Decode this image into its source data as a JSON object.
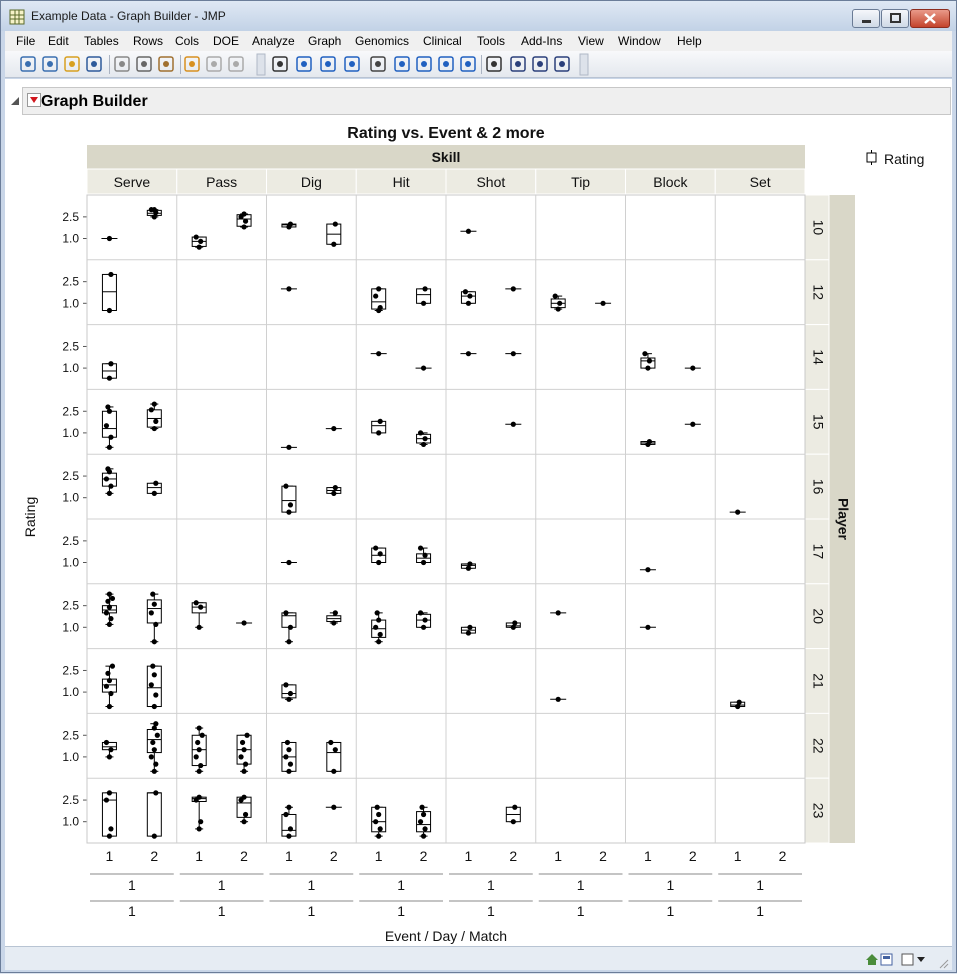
{
  "window": {
    "title": "Example Data - Graph Builder - JMP"
  },
  "menu": [
    "File",
    "Edit",
    "Tables",
    "Rows",
    "Cols",
    "DOE",
    "Analyze",
    "Graph",
    "Genomics",
    "Clinical",
    "Tools",
    "Add-Ins",
    "View",
    "Window",
    "Help"
  ],
  "toolbar_icons": [
    "new-data-table-icon",
    "new-script-icon",
    "open-icon",
    "save-icon",
    "cut-icon",
    "copy-icon",
    "paste-icon",
    "print-icon",
    "report-icon",
    "run-icon",
    "arrow-tool-icon",
    "help-tool-icon",
    "selection-tool-icon",
    "crosshair-tool-icon",
    "hand-tool-icon",
    "brush-tool-icon",
    "lasso-tool-icon",
    "magnifier-tool-icon",
    "crosshair-plus-icon",
    "annotate-icon",
    "line-tool-icon",
    "polygon-tool-icon",
    "simple-shape-icon"
  ],
  "graph_builder": {
    "title": "Graph Builder"
  },
  "chart_data": {
    "type": "box",
    "title": "Rating vs. Event & 2 more",
    "y_label": "Rating",
    "x_label": "Event / Day / Match",
    "group_x_label": "Skill",
    "group_y_label": "Player",
    "legend": "Rating",
    "skills": [
      "Serve",
      "Pass",
      "Dig",
      "Hit",
      "Shot",
      "Tip",
      "Block",
      "Set"
    ],
    "players": [
      "10",
      "12",
      "14",
      "15",
      "16",
      "17",
      "20",
      "21",
      "22",
      "23"
    ],
    "y_ticks": [
      "2.5",
      "1.0"
    ],
    "events": [
      "1",
      "2"
    ],
    "day_labels": [
      "1",
      "1",
      "1",
      "1",
      "1",
      "1",
      "1",
      "1"
    ],
    "match_labels": [
      "1",
      "1",
      "1",
      "1",
      "1",
      "1",
      "1",
      "1"
    ],
    "cells": [
      {
        "player": "10",
        "skill": "Serve",
        "event": "1",
        "points": [
          1.0
        ]
      },
      {
        "player": "10",
        "skill": "Serve",
        "event": "2",
        "points": [
          2.5,
          2.8,
          3.0,
          3.0
        ],
        "box": [
          2.5,
          2.6,
          2.75,
          2.95,
          3.0
        ]
      },
      {
        "player": "10",
        "skill": "Pass",
        "event": "1",
        "points": [
          0.4,
          0.8,
          1.1
        ],
        "box": [
          0.4,
          0.45,
          0.8,
          1.1,
          1.1
        ]
      },
      {
        "player": "10",
        "skill": "Pass",
        "event": "2",
        "points": [
          1.8,
          2.2,
          2.5,
          2.7
        ],
        "box": [
          1.8,
          1.85,
          2.35,
          2.65,
          2.7
        ]
      },
      {
        "player": "10",
        "skill": "Dig",
        "event": "1",
        "points": [
          1.8,
          2.0
        ],
        "box": [
          1.8,
          1.8,
          1.95,
          2.0,
          2.0
        ]
      },
      {
        "player": "10",
        "skill": "Dig",
        "event": "2",
        "points": [
          0.6,
          2.0
        ],
        "box": [
          0.6,
          0.6,
          1.3,
          2.0,
          2.0
        ]
      },
      {
        "player": "10",
        "skill": "Shot",
        "event": "1",
        "points": [
          1.5
        ]
      },
      {
        "player": "12",
        "skill": "Serve",
        "event": "1",
        "points": [
          0.5,
          3.0
        ],
        "box": [
          0.5,
          0.5,
          1.8,
          3.0,
          3.0
        ]
      },
      {
        "player": "12",
        "skill": "Dig",
        "event": "1",
        "points": [
          2.0
        ]
      },
      {
        "player": "12",
        "skill": "Hit",
        "event": "1",
        "points": [
          0.5,
          0.7,
          1.5,
          2.0
        ],
        "box": [
          0.5,
          0.6,
          1.1,
          2.0,
          2.0
        ]
      },
      {
        "player": "12",
        "skill": "Hit",
        "event": "2",
        "points": [
          1.0,
          2.0
        ],
        "box": [
          1.0,
          1.0,
          1.6,
          2.0,
          2.0
        ]
      },
      {
        "player": "12",
        "skill": "Shot",
        "event": "1",
        "points": [
          1.0,
          1.5,
          1.8
        ],
        "box": [
          1.0,
          1.0,
          1.5,
          1.8,
          1.8
        ]
      },
      {
        "player": "12",
        "skill": "Shot",
        "event": "2",
        "points": [
          2.0
        ]
      },
      {
        "player": "12",
        "skill": "Tip",
        "event": "1",
        "points": [
          0.6,
          1.0,
          1.5
        ],
        "box": [
          0.6,
          0.7,
          1.0,
          1.3,
          1.5
        ]
      },
      {
        "player": "12",
        "skill": "Tip",
        "event": "2",
        "points": [
          1.0
        ]
      },
      {
        "player": "14",
        "skill": "Serve",
        "event": "1",
        "points": [
          0.3,
          1.3
        ],
        "box": [
          0.3,
          0.3,
          0.8,
          1.3,
          1.3
        ]
      },
      {
        "player": "14",
        "skill": "Hit",
        "event": "1",
        "points": [
          2.0
        ]
      },
      {
        "player": "14",
        "skill": "Hit",
        "event": "2",
        "points": [
          1.0
        ]
      },
      {
        "player": "14",
        "skill": "Shot",
        "event": "1",
        "points": [
          2.0
        ]
      },
      {
        "player": "14",
        "skill": "Shot",
        "event": "2",
        "points": [
          2.0
        ]
      },
      {
        "player": "14",
        "skill": "Block",
        "event": "1",
        "points": [
          1.0,
          1.5,
          2.0
        ],
        "box": [
          1.0,
          1.0,
          1.5,
          1.7,
          2.0
        ]
      },
      {
        "player": "14",
        "skill": "Block",
        "event": "2",
        "points": [
          1.0
        ]
      },
      {
        "player": "15",
        "skill": "Serve",
        "event": "1",
        "points": [
          0.0,
          0.7,
          1.5,
          2.5,
          2.8
        ],
        "box": [
          0.0,
          0.7,
          1.3,
          2.5,
          2.8
        ]
      },
      {
        "player": "15",
        "skill": "Serve",
        "event": "2",
        "points": [
          1.3,
          1.8,
          2.6,
          3.0
        ],
        "box": [
          1.3,
          1.4,
          2.0,
          2.6,
          3.0
        ]
      },
      {
        "player": "15",
        "skill": "Dig",
        "event": "1",
        "points": [
          0.0
        ]
      },
      {
        "player": "15",
        "skill": "Dig",
        "event": "2",
        "points": [
          1.3
        ]
      },
      {
        "player": "15",
        "skill": "Hit",
        "event": "1",
        "points": [
          1.0,
          1.8
        ],
        "box": [
          1.0,
          1.0,
          1.5,
          1.8,
          1.8
        ]
      },
      {
        "player": "15",
        "skill": "Hit",
        "event": "2",
        "points": [
          0.2,
          0.6,
          1.0
        ],
        "box": [
          0.2,
          0.3,
          0.6,
          0.9,
          1.0
        ]
      },
      {
        "player": "15",
        "skill": "Shot",
        "event": "2",
        "points": [
          1.6
        ]
      },
      {
        "player": "15",
        "skill": "Block",
        "event": "1",
        "points": [
          0.2,
          0.4
        ],
        "box": [
          0.2,
          0.2,
          0.3,
          0.4,
          0.4
        ]
      },
      {
        "player": "15",
        "skill": "Block",
        "event": "2",
        "points": [
          1.6
        ]
      },
      {
        "player": "16",
        "skill": "Serve",
        "event": "1",
        "points": [
          1.3,
          1.8,
          2.3,
          2.8,
          3.0
        ],
        "box": [
          1.3,
          1.8,
          2.3,
          2.7,
          3.0
        ]
      },
      {
        "player": "16",
        "skill": "Serve",
        "event": "2",
        "points": [
          1.3,
          2.0
        ],
        "box": [
          1.3,
          1.3,
          1.7,
          2.0,
          2.0
        ]
      },
      {
        "player": "16",
        "skill": "Dig",
        "event": "1",
        "points": [
          0.0,
          0.5,
          1.8
        ],
        "box": [
          0.0,
          0.0,
          0.8,
          1.8,
          1.8
        ]
      },
      {
        "player": "16",
        "skill": "Dig",
        "event": "2",
        "points": [
          1.3,
          1.7
        ],
        "box": [
          1.3,
          1.3,
          1.5,
          1.7,
          1.7
        ]
      },
      {
        "player": "16",
        "skill": "Set",
        "event": "1",
        "points": [
          0.0
        ]
      },
      {
        "player": "17",
        "skill": "Dig",
        "event": "1",
        "points": [
          1.0
        ]
      },
      {
        "player": "17",
        "skill": "Hit",
        "event": "1",
        "points": [
          1.0,
          1.6,
          2.0
        ],
        "box": [
          1.0,
          1.0,
          1.5,
          2.0,
          2.0
        ]
      },
      {
        "player": "17",
        "skill": "Hit",
        "event": "2",
        "points": [
          1.0,
          1.5,
          2.0
        ],
        "box": [
          1.0,
          1.0,
          1.3,
          1.6,
          2.0
        ]
      },
      {
        "player": "17",
        "skill": "Shot",
        "event": "1",
        "points": [
          0.6,
          0.9
        ],
        "box": [
          0.6,
          0.6,
          0.8,
          0.9,
          0.9
        ]
      },
      {
        "player": "17",
        "skill": "Block",
        "event": "1",
        "points": [
          0.5
        ]
      },
      {
        "player": "20",
        "skill": "Serve",
        "event": "1",
        "points": [
          1.2,
          1.6,
          2.0,
          2.4,
          2.8,
          3.0,
          3.3
        ],
        "box": [
          1.2,
          2.0,
          2.2,
          2.5,
          3.3
        ]
      },
      {
        "player": "20",
        "skill": "Serve",
        "event": "2",
        "points": [
          0.0,
          1.2,
          2.0,
          2.6,
          3.3
        ],
        "box": [
          0.0,
          1.3,
          2.3,
          2.9,
          3.3
        ]
      },
      {
        "player": "20",
        "skill": "Pass",
        "event": "1",
        "points": [
          1.0,
          2.4,
          2.7
        ],
        "box": [
          1.0,
          2.0,
          2.4,
          2.7,
          2.7
        ]
      },
      {
        "player": "20",
        "skill": "Pass",
        "event": "2",
        "points": [
          1.3
        ]
      },
      {
        "player": "20",
        "skill": "Dig",
        "event": "1",
        "points": [
          0.0,
          1.0,
          2.0
        ],
        "box": [
          0.0,
          1.0,
          1.8,
          2.0,
          2.0
        ]
      },
      {
        "player": "20",
        "skill": "Dig",
        "event": "2",
        "points": [
          1.3,
          2.0
        ],
        "box": [
          1.3,
          1.4,
          1.6,
          1.8,
          2.0
        ]
      },
      {
        "player": "20",
        "skill": "Hit",
        "event": "1",
        "points": [
          0.0,
          0.5,
          1.0,
          1.5,
          2.0
        ],
        "box": [
          0.0,
          0.3,
          0.9,
          1.5,
          2.0
        ]
      },
      {
        "player": "20",
        "skill": "Hit",
        "event": "2",
        "points": [
          1.0,
          1.5,
          2.0
        ],
        "box": [
          1.0,
          1.0,
          1.5,
          1.9,
          2.0
        ]
      },
      {
        "player": "20",
        "skill": "Shot",
        "event": "1",
        "points": [
          0.6,
          1.0
        ],
        "box": [
          0.6,
          0.6,
          0.8,
          1.0,
          1.0
        ]
      },
      {
        "player": "20",
        "skill": "Shot",
        "event": "2",
        "points": [
          1.0,
          1.3
        ],
        "box": [
          1.0,
          1.0,
          1.1,
          1.3,
          1.3
        ]
      },
      {
        "player": "20",
        "skill": "Tip",
        "event": "1",
        "points": [
          2.0
        ]
      },
      {
        "player": "20",
        "skill": "Block",
        "event": "1",
        "points": [
          1.0
        ]
      },
      {
        "player": "21",
        "skill": "Serve",
        "event": "1",
        "points": [
          0.0,
          0.9,
          1.4,
          1.8,
          2.3,
          2.8
        ],
        "box": [
          0.0,
          1.0,
          1.5,
          1.9,
          2.8
        ]
      },
      {
        "player": "21",
        "skill": "Serve",
        "event": "2",
        "points": [
          0.0,
          0.8,
          1.5,
          2.2,
          2.8
        ],
        "box": [
          0.0,
          0.0,
          1.3,
          2.8,
          2.8
        ]
      },
      {
        "player": "21",
        "skill": "Dig",
        "event": "1",
        "points": [
          0.5,
          0.9,
          1.5
        ],
        "box": [
          0.5,
          0.6,
          0.9,
          1.5,
          1.5
        ]
      },
      {
        "player": "21",
        "skill": "Tip",
        "event": "1",
        "points": [
          0.5
        ]
      },
      {
        "player": "21",
        "skill": "Set",
        "event": "1",
        "points": [
          0.0,
          0.3
        ],
        "box": [
          0.0,
          0.0,
          0.1,
          0.3,
          0.3
        ]
      },
      {
        "player": "22",
        "skill": "Serve",
        "event": "1",
        "points": [
          1.0,
          1.5,
          2.0
        ],
        "box": [
          1.0,
          1.5,
          1.7,
          2.0,
          2.0
        ]
      },
      {
        "player": "22",
        "skill": "Serve",
        "event": "2",
        "points": [
          0.0,
          0.5,
          1.0,
          1.5,
          2.0,
          2.5,
          3.0,
          3.3
        ],
        "box": [
          0.0,
          1.3,
          2.2,
          2.9,
          3.3
        ]
      },
      {
        "player": "22",
        "skill": "Pass",
        "event": "1",
        "points": [
          0.0,
          0.4,
          1.0,
          1.5,
          2.0,
          2.5,
          3.0
        ],
        "box": [
          0.0,
          0.4,
          1.5,
          2.5,
          3.0
        ]
      },
      {
        "player": "22",
        "skill": "Pass",
        "event": "2",
        "points": [
          0.0,
          0.5,
          1.0,
          1.5,
          2.0,
          2.5
        ],
        "box": [
          0.0,
          0.5,
          1.5,
          2.5,
          2.5
        ]
      },
      {
        "player": "22",
        "skill": "Dig",
        "event": "1",
        "points": [
          0.0,
          0.5,
          1.0,
          1.5,
          2.0
        ],
        "box": [
          0.0,
          0.0,
          1.0,
          2.0,
          2.0
        ]
      },
      {
        "player": "22",
        "skill": "Dig",
        "event": "2",
        "points": [
          0.0,
          1.5,
          2.0
        ],
        "box": [
          0.0,
          0.0,
          1.3,
          2.0,
          2.0
        ]
      },
      {
        "player": "23",
        "skill": "Serve",
        "event": "1",
        "points": [
          0.0,
          0.5,
          2.5,
          3.0
        ],
        "box": [
          0.0,
          0.0,
          2.5,
          3.0,
          3.0
        ]
      },
      {
        "player": "23",
        "skill": "Serve",
        "event": "2",
        "points": [
          0.0,
          3.0
        ],
        "box": [
          0.0,
          0.0,
          3.0,
          3.0,
          3.0
        ]
      },
      {
        "player": "23",
        "skill": "Pass",
        "event": "1",
        "points": [
          0.5,
          1.0,
          2.5,
          2.7
        ],
        "box": [
          0.5,
          2.4,
          2.6,
          2.7,
          2.7
        ]
      },
      {
        "player": "23",
        "skill": "Pass",
        "event": "2",
        "points": [
          1.0,
          1.5,
          2.5,
          2.7
        ],
        "box": [
          1.0,
          1.3,
          2.3,
          2.7,
          2.7
        ]
      },
      {
        "player": "23",
        "skill": "Dig",
        "event": "1",
        "points": [
          0.0,
          0.5,
          1.5,
          2.0
        ],
        "box": [
          0.0,
          0.0,
          0.4,
          1.5,
          2.0
        ]
      },
      {
        "player": "23",
        "skill": "Dig",
        "event": "2",
        "points": [
          2.0
        ]
      },
      {
        "player": "23",
        "skill": "Hit",
        "event": "1",
        "points": [
          0.0,
          0.5,
          1.0,
          1.5,
          2.0
        ],
        "box": [
          0.0,
          0.3,
          1.0,
          2.0,
          2.0
        ]
      },
      {
        "player": "23",
        "skill": "Hit",
        "event": "2",
        "points": [
          0.0,
          0.5,
          1.0,
          1.5,
          2.0
        ],
        "box": [
          0.0,
          0.3,
          0.8,
          1.7,
          2.0
        ]
      },
      {
        "player": "23",
        "skill": "Shot",
        "event": "2",
        "points": [
          1.0,
          2.0
        ],
        "box": [
          1.0,
          1.0,
          1.5,
          2.0,
          2.0
        ]
      }
    ]
  }
}
